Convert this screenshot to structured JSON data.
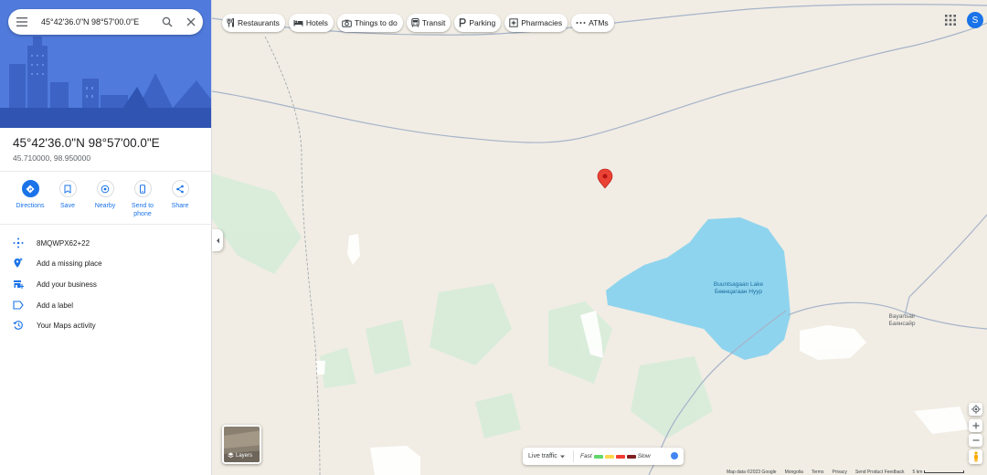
{
  "search": {
    "query": "45°42'36.0\"N 98°57'00.0\"E"
  },
  "place": {
    "title": "45°42'36.0\"N 98°57'00.0\"E",
    "coordinates": "45.710000, 98.950000"
  },
  "actions": [
    {
      "label": "Directions",
      "icon": "directions-icon"
    },
    {
      "label": "Save",
      "icon": "bookmark-icon"
    },
    {
      "label": "Nearby",
      "icon": "nearby-icon"
    },
    {
      "label": "Send to phone",
      "icon": "phone-icon"
    },
    {
      "label": "Share",
      "icon": "share-icon"
    }
  ],
  "details": [
    {
      "text": "8MQWPX62+22",
      "icon": "plus-code-icon"
    },
    {
      "text": "Add a missing place",
      "icon": "add-place-icon"
    },
    {
      "text": "Add your business",
      "icon": "add-business-icon"
    },
    {
      "text": "Add a label",
      "icon": "label-icon"
    },
    {
      "text": "Your Maps activity",
      "icon": "history-icon"
    }
  ],
  "chips": [
    {
      "label": "Restaurants",
      "icon": "restaurant-icon"
    },
    {
      "label": "Hotels",
      "icon": "hotel-icon"
    },
    {
      "label": "Things to do",
      "icon": "camera-icon"
    },
    {
      "label": "Transit",
      "icon": "transit-icon"
    },
    {
      "label": "Parking",
      "icon": "parking-icon"
    },
    {
      "label": "Pharmacies",
      "icon": "pharmacy-icon"
    },
    {
      "label": "ATMs",
      "icon": "atm-icon"
    }
  ],
  "account": {
    "initial": "S"
  },
  "layers": {
    "label": "Layers"
  },
  "traffic": {
    "label": "Live traffic",
    "fast": "Fast",
    "slow": "Slow",
    "colors": [
      "#63d668",
      "#ffd74d",
      "#f23c32",
      "#811f1f"
    ]
  },
  "map_labels": {
    "lake_en": "Buuntsagaan Lake",
    "lake_mn": "Бөөнцагаан Нуур",
    "town_en": "Bayansair",
    "town_mn": "Баянсайр"
  },
  "footer": {
    "map_data": "Map data ©2023 Google",
    "country": "Mongolia",
    "terms": "Terms",
    "privacy": "Privacy",
    "feedback": "Send Product Feedback",
    "scale": "5 km"
  },
  "colors": {
    "land": "#f1ede4",
    "water": "#8fd4ee",
    "green": "#d7ecd9",
    "road": "#a6b3c9",
    "accent": "#1a73e8",
    "pin": "#ea4335"
  }
}
